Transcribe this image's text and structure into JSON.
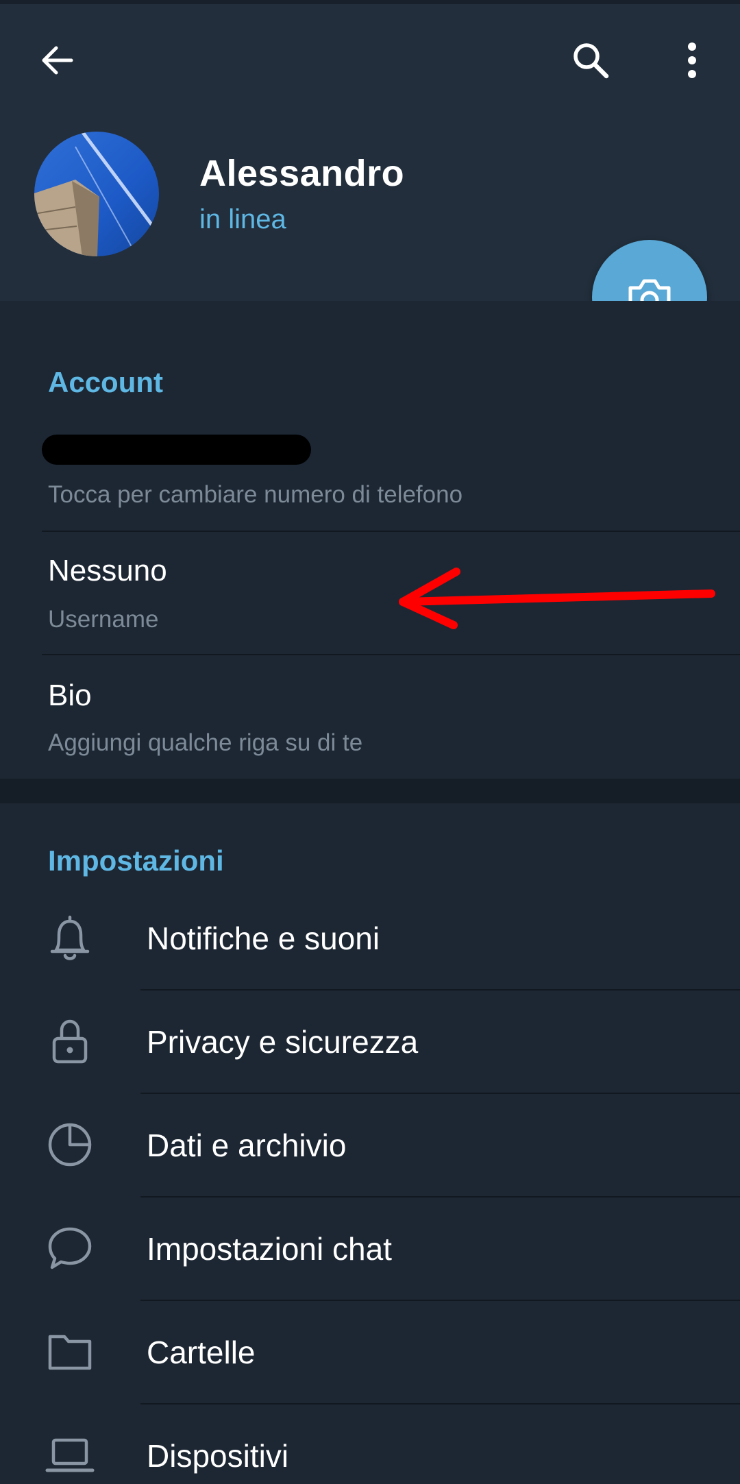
{
  "header": {
    "back_icon": "arrow-left-icon",
    "search_icon": "search-icon",
    "more_icon": "more-vertical-icon",
    "profile_name": "Alessandro",
    "profile_status": "in linea",
    "camera_icon": "camera-icon"
  },
  "account": {
    "title": "Account",
    "phone_hint": "Tocca per cambiare numero di telefono",
    "username_value": "Nessuno",
    "username_hint": "Username",
    "bio_value": "Bio",
    "bio_hint": "Aggiungi qualche riga su di te"
  },
  "settings": {
    "title": "Impostazioni",
    "items": [
      {
        "label": "Notifiche e suoni",
        "icon": "bell-icon"
      },
      {
        "label": "Privacy e sicurezza",
        "icon": "lock-icon"
      },
      {
        "label": "Dati e archivio",
        "icon": "pie-chart-icon"
      },
      {
        "label": "Impostazioni chat",
        "icon": "chat-bubble-icon"
      },
      {
        "label": "Cartelle",
        "icon": "folder-icon"
      },
      {
        "label": "Dispositivi",
        "icon": "laptop-icon"
      }
    ]
  },
  "colors": {
    "accent": "#5fb7e4",
    "background": "#1d2733",
    "header": "#222e3b",
    "fab": "#5aa8d6",
    "annotation_arrow": "#ff0000"
  }
}
